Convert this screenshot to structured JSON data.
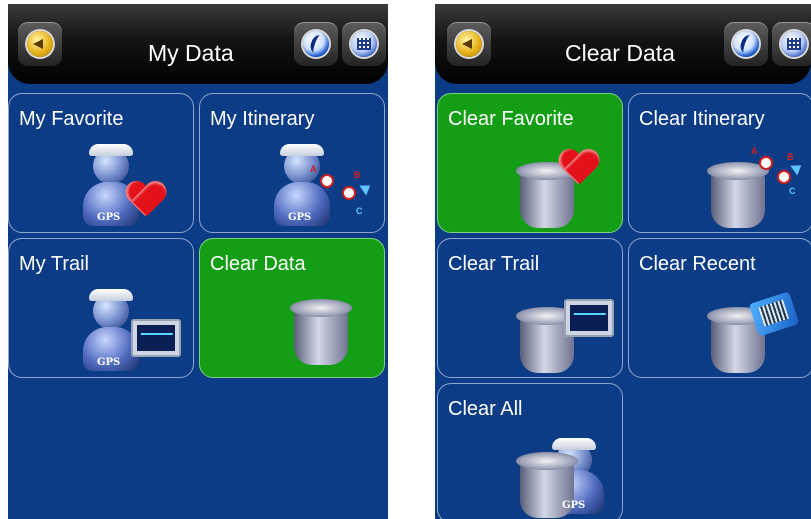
{
  "left_screen": {
    "title": "My Data",
    "header_icons": [
      "back-icon",
      "swirl-icon",
      "grid-icon"
    ],
    "tiles": [
      {
        "label": "My Favorite",
        "icon": "gps-person-heart-icon",
        "badge": "GPS"
      },
      {
        "label": "My Itinerary",
        "icon": "gps-person-route-icon",
        "badge": "GPS",
        "route_letters": [
          "A",
          "B",
          "C"
        ]
      },
      {
        "label": "My Trail",
        "icon": "gps-person-monitor-icon",
        "badge": "GPS"
      },
      {
        "label": "Clear Data",
        "icon": "trash-bin-icon",
        "selected": true
      }
    ]
  },
  "right_screen": {
    "title": "Clear Data",
    "header_icons": [
      "back-icon",
      "swirl-icon",
      "grid-icon"
    ],
    "tiles": [
      {
        "label": "Clear Favorite",
        "icon": "bin-heart-icon",
        "selected": true
      },
      {
        "label": "Clear Itinerary",
        "icon": "bin-route-icon",
        "route_letters": [
          "A",
          "B",
          "C"
        ]
      },
      {
        "label": "Clear Trail",
        "icon": "bin-monitor-icon"
      },
      {
        "label": "Clear Recent",
        "icon": "bin-book-icon"
      },
      {
        "label": "Clear All",
        "icon": "bin-gps-person-icon",
        "badge": "GPS"
      }
    ]
  },
  "colors": {
    "background": "#0c3c86",
    "tile_border": "#8fa6cc",
    "selected_tile": "#139e16",
    "header": "#000000",
    "text": "#ffffff"
  }
}
